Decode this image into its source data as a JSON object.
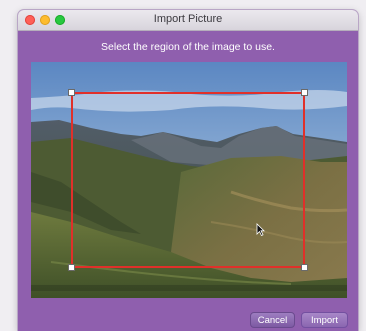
{
  "window": {
    "title": "Import Picture"
  },
  "dialog": {
    "instruction": "Select the region of the image to use."
  },
  "image": {
    "description_icon": "landscape-photo"
  },
  "buttons": {
    "cancel_label": "Cancel",
    "import_label": "Import"
  },
  "colors": {
    "dialog_background": "#8f5fae",
    "crop_border": "#e0302a",
    "close": "#ff5f57",
    "minimize": "#febc2e",
    "zoom": "#28c840"
  }
}
